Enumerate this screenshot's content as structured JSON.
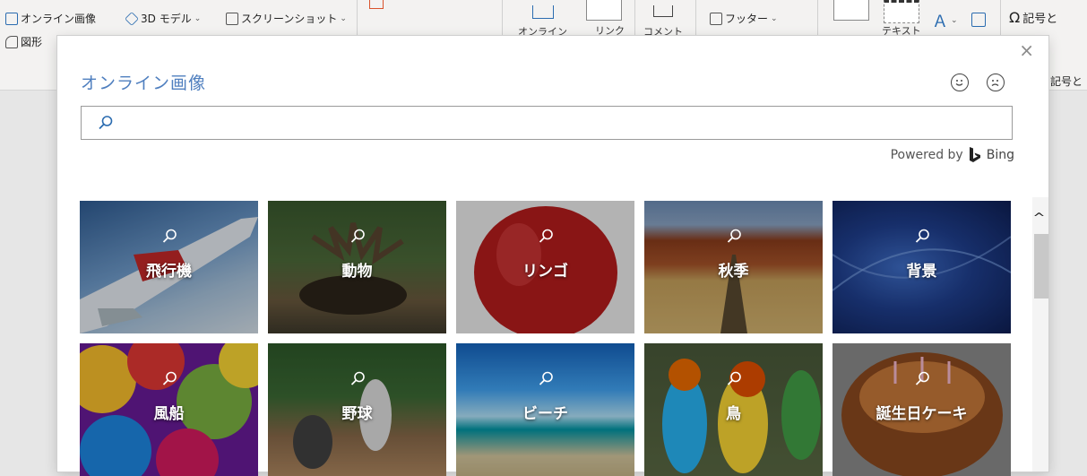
{
  "ribbon": {
    "online_image": "オンライン画像",
    "model_3d": "3D モデル",
    "screenshot": "スクリーンショット",
    "shapes": "図形",
    "online_video_short": "オンライン",
    "link": "リンク",
    "comment": "コメント",
    "footer": "フッター",
    "textbox": "テキスト",
    "symbol": "記号と",
    "symbol_group": "記号と"
  },
  "dialog": {
    "title": "オンライン画像",
    "search_placeholder": "",
    "search_value": "",
    "powered_by": "Powered by",
    "powered_brand": "Bing",
    "close_glyph": "×"
  },
  "tiles": [
    {
      "label": "飛行機"
    },
    {
      "label": "動物"
    },
    {
      "label": "リンゴ"
    },
    {
      "label": "秋季"
    },
    {
      "label": "背景"
    },
    {
      "label": "風船"
    },
    {
      "label": "野球"
    },
    {
      "label": "ビーチ"
    },
    {
      "label": "鳥"
    },
    {
      "label": "誕生日ケーキ"
    }
  ],
  "scrollbar": {
    "up_glyph": "^"
  },
  "colors": {
    "title": "#4f7fbf",
    "dialog_bg": "#ffffff",
    "ribbon_bg": "#f3f2f1"
  }
}
